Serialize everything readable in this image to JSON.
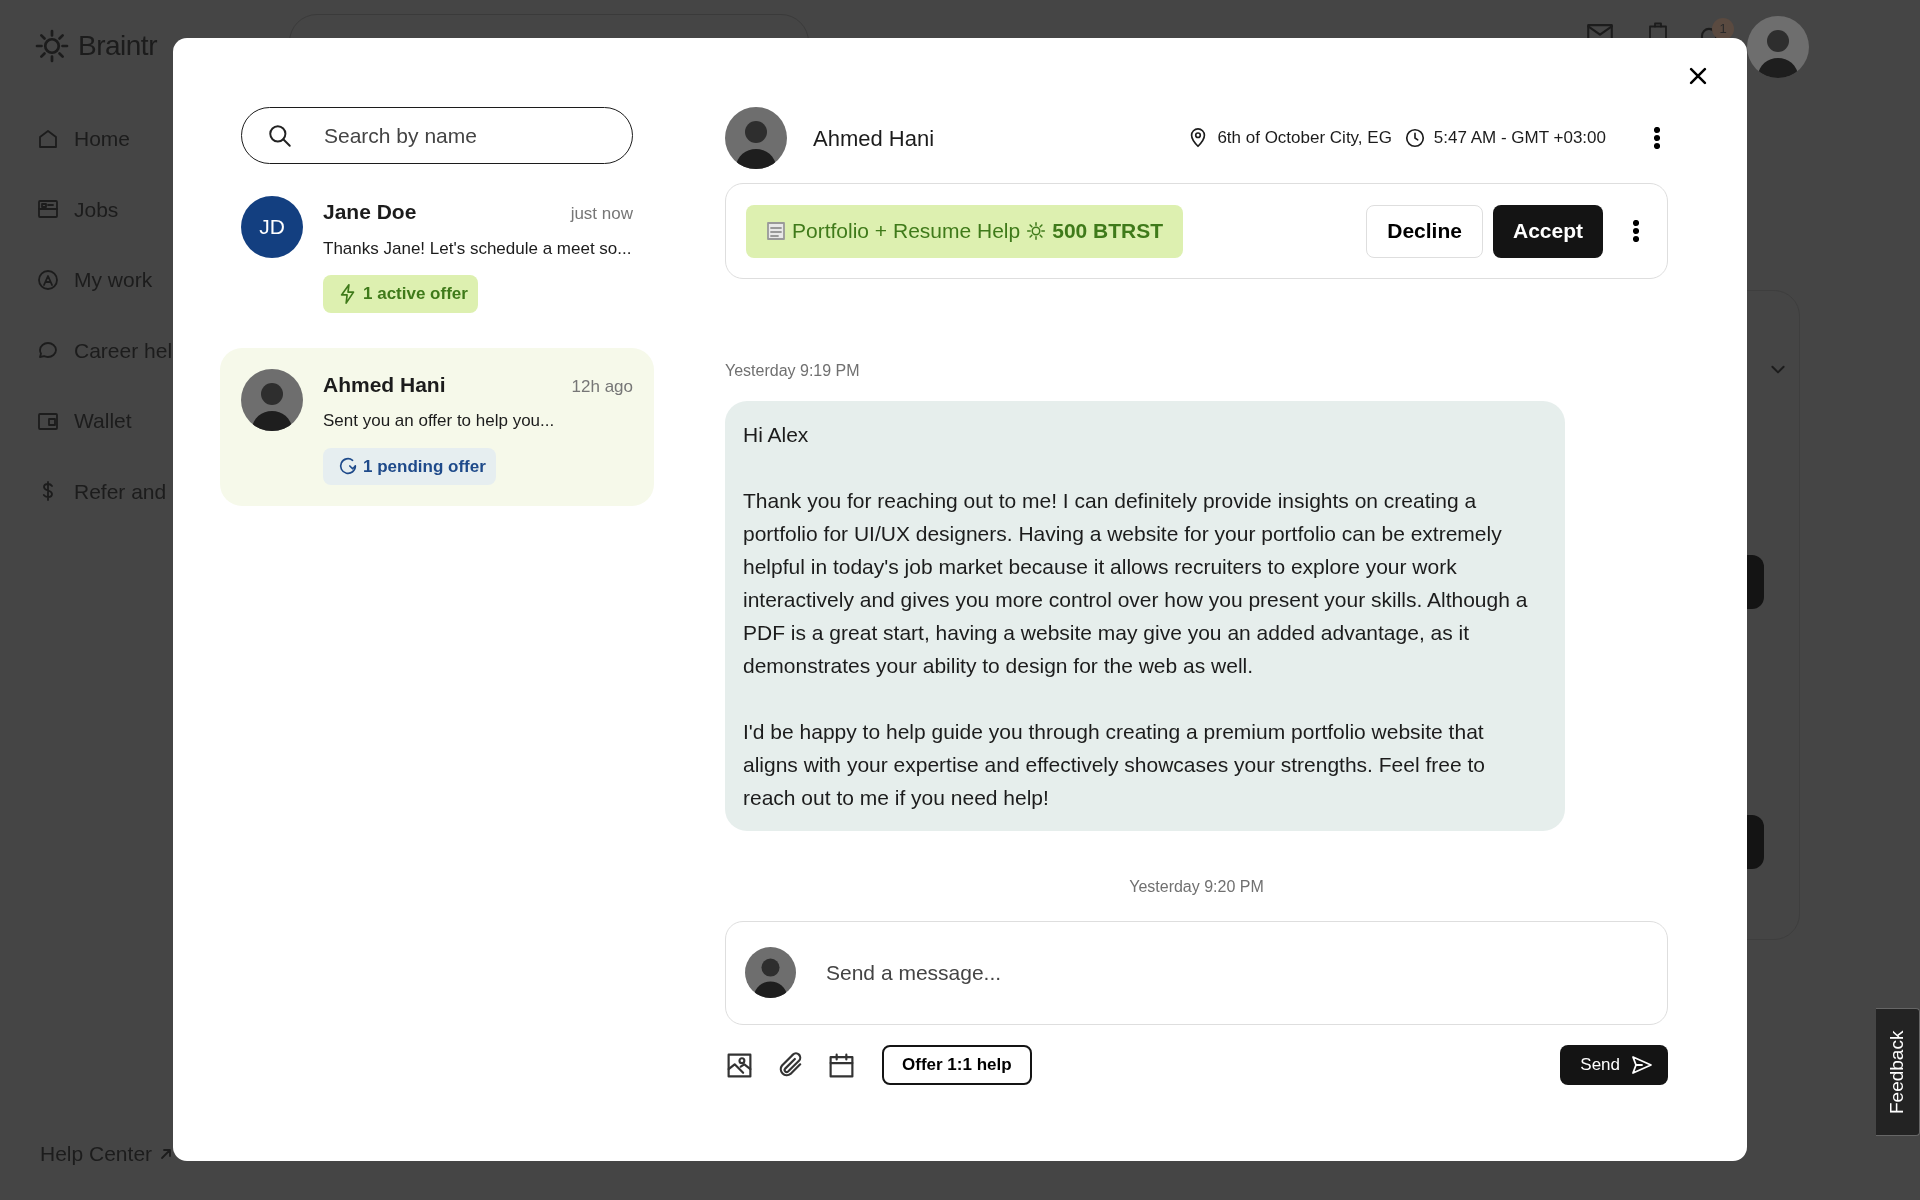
{
  "background": {
    "logo": "Braintr",
    "nav": [
      {
        "label": "Home"
      },
      {
        "label": "Jobs"
      },
      {
        "label": "My work"
      },
      {
        "label": "Career hel"
      },
      {
        "label": "Wallet"
      },
      {
        "label": "Refer and"
      }
    ],
    "help_link": "Help Center",
    "notification_count": "1",
    "feedback": "Feedback"
  },
  "dialog": {
    "search": {
      "placeholder": "Search by name"
    },
    "conversations": [
      {
        "name": "Jane Doe",
        "time": "just now",
        "preview": "Thanks Jane! Let's schedule a meet so...",
        "avatar": {
          "kind": "initials",
          "initials": "JD"
        },
        "offer": {
          "kind": "active",
          "label": "1 active offer"
        },
        "selected": false
      },
      {
        "name": "Ahmed Hani",
        "time": "12h ago",
        "preview": "Sent you an offer to help you...",
        "offer": {
          "kind": "pending",
          "label": "1 pending offer"
        },
        "selected": true
      }
    ],
    "contact": {
      "name": "Ahmed Hani",
      "location": "6th of October City, EG",
      "local_time": "5:47 AM - GMT +03:00"
    },
    "offer": {
      "title": "Portfolio + Resume Help",
      "amount": "500 BTRST",
      "decline": "Decline",
      "accept": "Accept"
    },
    "messages": [
      {
        "kind": "timestamp",
        "text": "Yesterday 9:19 PM"
      },
      {
        "kind": "bubble",
        "paragraphs": [
          "Hi Alex",
          "Thank you for reaching out to me! I can definitely provide insights on creating a portfolio for UI/UX designers. Having a website for your portfolio can be extremely helpful in today's job market because it allows recruiters to explore your work interactively and gives you more control over how you present your skills. Although a PDF is a great start, having a website may give you an added advantage, as it demonstrates your ability to design for the web as well.",
          "I'd be happy to help guide you through creating a premium portfolio website that aligns with your expertise and effectively showcases your strengths. Feel free to reach out to me if you need help!"
        ]
      },
      {
        "kind": "timestamp",
        "text": "Yesterday 9:20 PM"
      }
    ],
    "composer": {
      "placeholder": "Send a message...",
      "offer_button": "Offer 1:1 help",
      "send": "Send"
    }
  }
}
